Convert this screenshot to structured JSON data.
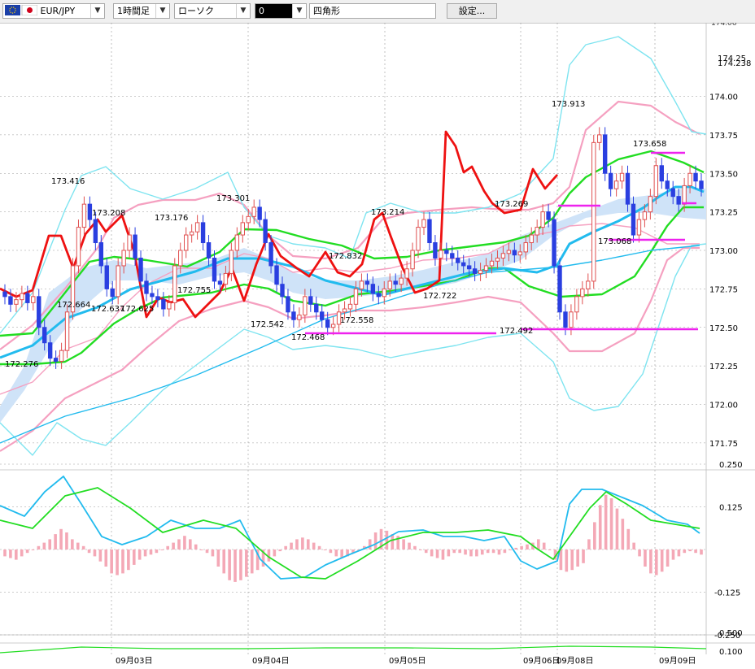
{
  "toolbar": {
    "symbol": "EUR/JPY",
    "timeframe": "1時間足",
    "chart_style": "ローソク",
    "draw_tool_value": "0",
    "draw_shape": "四角形",
    "settings_label": "設定...",
    "flag_icons": [
      "eu-flag-icon",
      "japan-flag-icon"
    ]
  },
  "colors": {
    "up_candle": "#e05050",
    "down_candle": "#2a3fe0",
    "ichimoku_red": "#ee1111",
    "bollinger_pink": "#f5a0c0",
    "bollinger_cyan": "#7ee4f0",
    "middle_green": "#22dd22",
    "ma_blue": "#22bbee",
    "cloud": "#cfe3f8",
    "horizontal_magenta": "#ee22ee",
    "grid": "#9a9a9a"
  },
  "chart_data": [
    {
      "type": "candlestick",
      "panel": "price",
      "y_ticks": [
        "174.00",
        "173.75",
        "173.50",
        "173.25",
        "173.00",
        "172.75",
        "172.50",
        "172.25",
        "172.00",
        "171.75"
      ],
      "ylim": [
        171.75,
        174.0
      ],
      "top_labels": [
        "174.06",
        "174.25",
        "174.238"
      ],
      "x_ticks": [
        "09月03日",
        "09月04日",
        "09月05日",
        "09月06日",
        "09月08日",
        "09月09日"
      ],
      "annotations": [
        "173.416",
        "173.208",
        "173.176",
        "173.301",
        "173.214",
        "173.269",
        "173.913",
        "173.658",
        "172.276",
        "172.664",
        "172.637",
        "172.625",
        "172.755",
        "172.542",
        "172.468",
        "172.558",
        "172.832",
        "172.722",
        "172.492",
        "173.068"
      ],
      "candle_closes": [
        172.7,
        172.65,
        172.68,
        172.72,
        172.66,
        172.7,
        172.5,
        172.4,
        172.3,
        172.28,
        172.35,
        172.6,
        172.9,
        173.15,
        173.3,
        173.2,
        173.05,
        172.9,
        172.75,
        172.7,
        172.9,
        173.0,
        173.1,
        172.95,
        172.8,
        172.72,
        172.7,
        172.68,
        172.62,
        172.66,
        172.9,
        173.0,
        173.1,
        173.12,
        173.18,
        173.05,
        172.95,
        172.8,
        172.78,
        172.85,
        173.0,
        173.1,
        173.18,
        173.22,
        173.28,
        173.2,
        173.05,
        172.9,
        172.78,
        172.7,
        172.6,
        172.55,
        172.58,
        172.7,
        172.65,
        172.6,
        172.55,
        172.5,
        172.52,
        172.6,
        172.62,
        172.65,
        172.75,
        172.8,
        172.78,
        172.72,
        172.7,
        172.75,
        172.8,
        172.78,
        172.82,
        172.88,
        173.0,
        173.15,
        173.2,
        173.05,
        172.95,
        173.0,
        172.98,
        172.95,
        172.92,
        172.9,
        172.88,
        172.85,
        172.87,
        172.9,
        172.93,
        172.95,
        172.98,
        173.0,
        172.97,
        172.99,
        173.05,
        173.1,
        173.15,
        173.25,
        173.2,
        172.9,
        172.6,
        172.5,
        172.6,
        172.7,
        172.75,
        172.8,
        173.7,
        173.75,
        173.5,
        173.4,
        173.45,
        173.5,
        173.3,
        173.1,
        173.2,
        173.25,
        173.35,
        173.55,
        173.45,
        173.4,
        173.35,
        173.3,
        173.42,
        173.5,
        173.45,
        173.4
      ]
    },
    {
      "type": "line",
      "panel": "macd",
      "y_ticks": [
        "0.250",
        "0.125",
        "-0.125",
        "-0.250"
      ]
    },
    {
      "type": "line",
      "panel": "bottom",
      "y_ticks": [
        "0.500",
        "0.100"
      ]
    }
  ]
}
